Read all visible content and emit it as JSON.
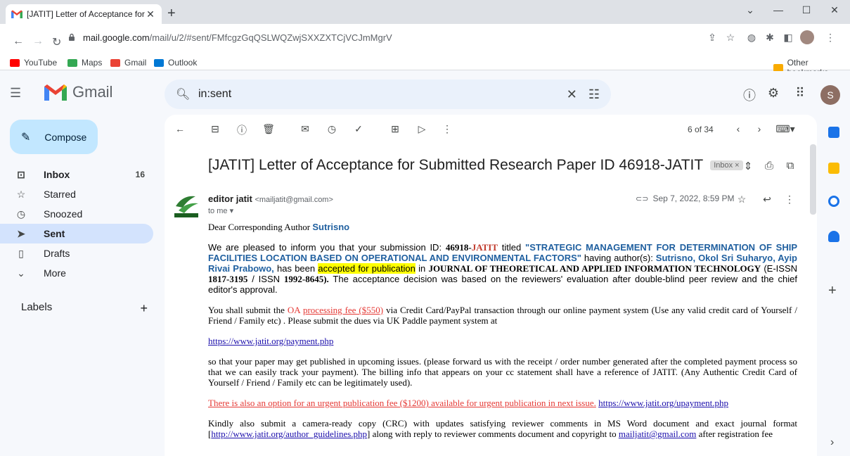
{
  "browser": {
    "tab_title": "[JATIT] Letter of Acceptance for S",
    "tab_close": "✕",
    "new_tab": "+",
    "url_host": "mail.google.com",
    "url_path": "/mail/u/2/#sent/FMfcgzGqQSLWQZwjSXXZXTCjVCJmMgrV",
    "bookmarks": [
      "YouTube",
      "Maps",
      "Gmail",
      "Outlook"
    ],
    "other_bookmarks": "Other bookmarks"
  },
  "gmail": {
    "logo_text": "Gmail",
    "search_query": "in:sent",
    "avatar_letter": "S",
    "compose_label": "Compose",
    "nav": [
      {
        "label": "Inbox",
        "count": "16"
      },
      {
        "label": "Starred",
        "count": ""
      },
      {
        "label": "Snoozed",
        "count": ""
      },
      {
        "label": "Sent",
        "count": ""
      },
      {
        "label": "Drafts",
        "count": ""
      },
      {
        "label": "More",
        "count": ""
      }
    ],
    "labels_title": "Labels",
    "labels_add": "+"
  },
  "message": {
    "pager": "6 of 34",
    "subject": "[JATIT] Letter of Acceptance for Submitted Research Paper ID 46918-JATIT",
    "inbox_badge": "Inbox ×",
    "sender_name": "editor jatit",
    "sender_email": "<mailjatit@gmail.com>",
    "to": "to me ▾",
    "date": "Sep 7, 2022, 8:59 PM",
    "greeting_prefix": "Dear Corresponding Author ",
    "greeting_name": "Sutrisno",
    "p1_a": "We are pleased to inform you that your submission ID: ",
    "p1_id": "46918-",
    "p1_jatit": "JATIT",
    "p1_b": " titled ",
    "p1_title": "\"STRATEGIC MANAGEMENT FOR DETERMINATION OF SHIP FACILITIES LOCATION BASED ON OPERATIONAL AND ENVIRONMENTAL FACTORS\"",
    "p1_c": " having author(s): ",
    "p1_authors": "Sutrisno, Okol Sri Suharyo, Ayip Rivai Prabowo,",
    "p1_d": " has been ",
    "p1_accepted": "accepted for publication",
    "p1_e": " in ",
    "p1_journal": "JOURNAL OF THEORETICAL AND APPLIED INFORMATION TECHNOLOGY",
    "p1_f": " (E-ISSN ",
    "p1_eissn": "1817-3195",
    "p1_g": " / ISSN ",
    "p1_issn": "1992-8645).",
    "p1_h": " The acceptance decision was based on the reviewers' evaluation after double-blind peer review and the chief editor's approval.",
    "p2_a": "You shall submit the ",
    "p2_oa": "OA",
    "p2_fee": "processing fee ($550)",
    "p2_b": " via Credit Card/PayPal transaction through our online payment system (Use any valid credit card of Yourself / Friend / Family etc) . Please submit the dues via UK Paddle payment system at",
    "p3_link": "https://www.jatit.org/payment.php",
    "p4": "so that your paper may get published in upcoming issues. (please forward us with the receipt / order number generated after the completed payment process so that we can easily track your payment). The billing info that appears on your cc statement shall have a reference of JATIT. (Any Authentic Credit Card of Yourself / Friend / Family etc can be legitimately used).",
    "p5_red": "There is also an option for an urgent publication fee ($1200) available for urgent publication in next issue.",
    "p5_link": "https://www.jatit.org/upayment.php",
    "p6_a": "Kindly also submit a camera-ready copy (CRC) with updates satisfying reviewer comments in MS Word document and exact journal format [",
    "p6_link": "http://www.jatit.org/author_guidelines.php",
    "p6_b": "] along with reply to reviewer comments document and copyright to ",
    "p6_email": "mailjatit@gmail.com",
    "p6_c": " after registration fee"
  }
}
